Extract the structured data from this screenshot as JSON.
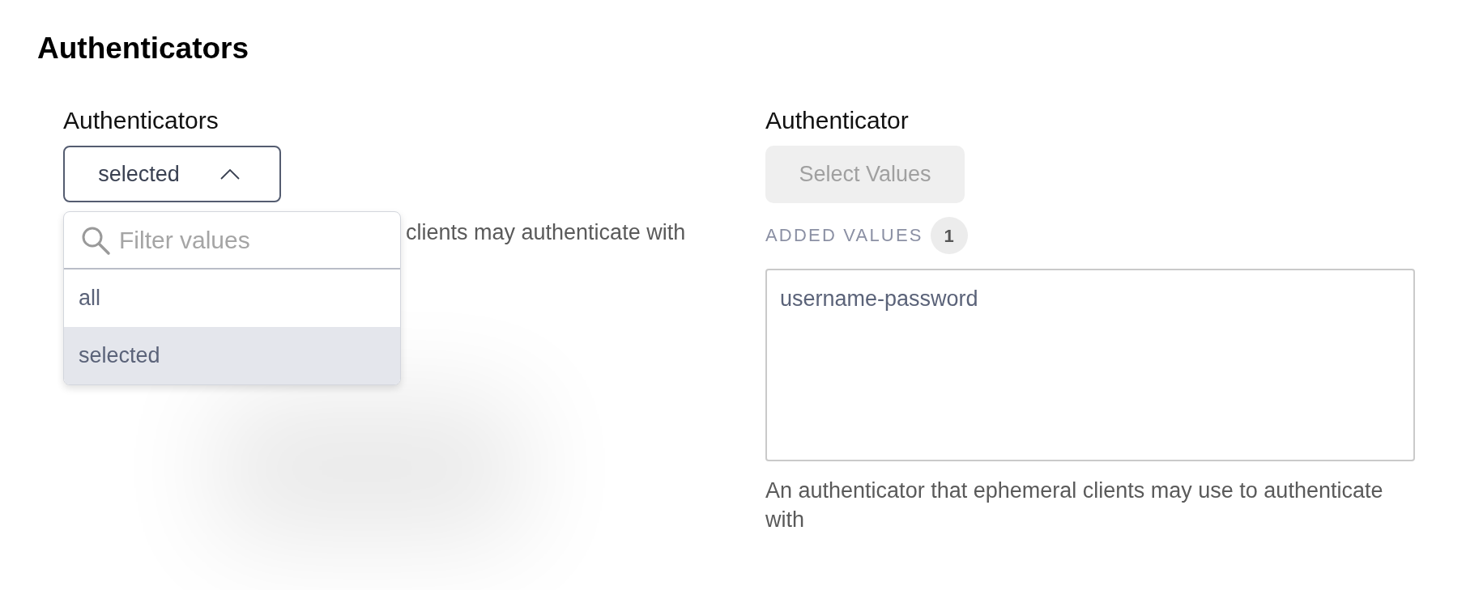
{
  "heading": "Authenticators",
  "left_field": {
    "label": "Authenticators",
    "select": {
      "value": "selected",
      "expanded": true
    },
    "dropdown": {
      "search": {
        "placeholder": "Filter values"
      },
      "options": [
        {
          "label": "all",
          "selected": false
        },
        {
          "label": "selected",
          "selected": true
        }
      ]
    },
    "description": "clients may authenticate with"
  },
  "right_field": {
    "label": "Authenticator",
    "button": {
      "label": "Select Values",
      "disabled": true
    },
    "added_values": {
      "label": "ADDED VALUES",
      "count": "1"
    },
    "values": [
      "username-password"
    ],
    "description": "An authenticator that ephemeral clients may use to authenticate with"
  }
}
